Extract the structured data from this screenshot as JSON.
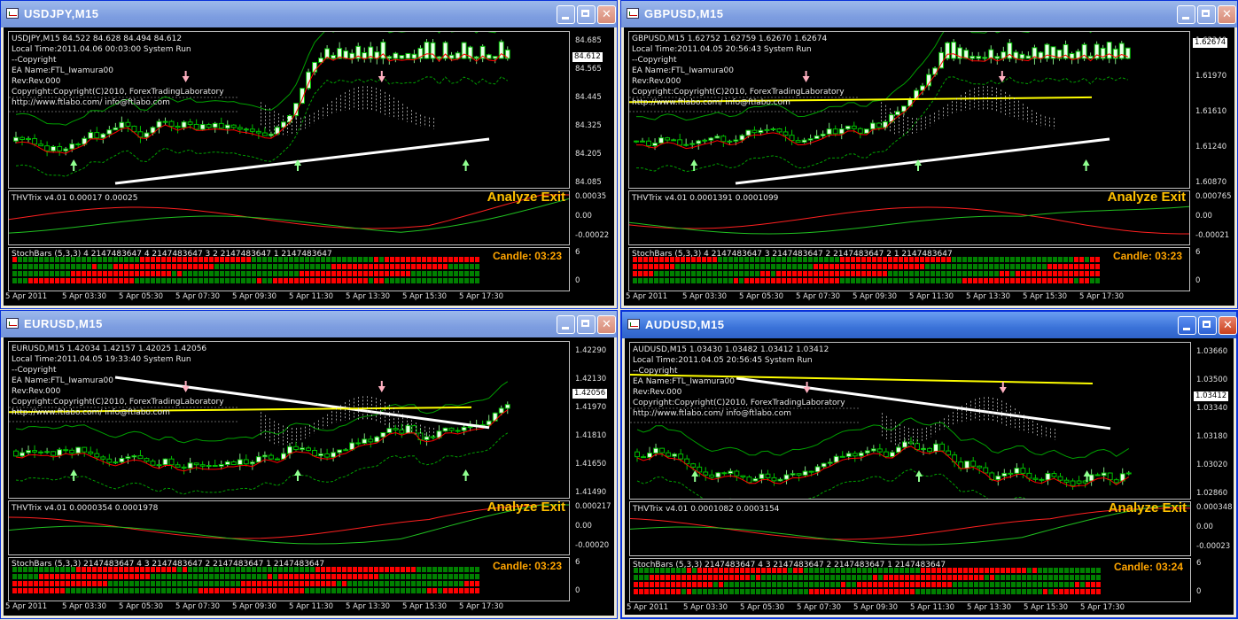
{
  "windows": [
    {
      "title": "USDJPY,M15",
      "active": false,
      "header": "USDJPY,M15  84.522 84.628 84.494 84.612",
      "info": [
        "Local Time:2011.04.06 00:03:00 System Run",
        "--Copyright",
        "EA Name:FTL_Iwamura00",
        "Rev:Rev.000",
        "Copyright:Copyright(C)2010, ForexTradingLaboratory",
        "http://www.ftlabo.com/ info@ftlabo.com"
      ],
      "price_ticks": [
        "84.685",
        "84.565",
        "84.445",
        "84.325",
        "84.205",
        "84.085"
      ],
      "current_price": "84.612",
      "trix_label": "THVTrix v4.01 0.00017 0.00025",
      "trix_ticks": [
        "0.00035",
        "0.00",
        "-0.00022"
      ],
      "stoch_label": "StochBars (5,3,3) 4 2147483647 4 2147483647 3 2 2147483647 1 2147483647",
      "stoch_ticks": [
        "6",
        "0"
      ],
      "candle_time": "Candle:  03:23",
      "exit_label": "Analyze Exit",
      "time_axis": [
        "5 Apr 2011",
        "5 Apr 03:30",
        "5 Apr 05:30",
        "5 Apr 07:30",
        "5 Apr 09:30",
        "5 Apr 11:30",
        "5 Apr 13:30",
        "5 Apr 15:30",
        "5 Apr 17:30"
      ],
      "seed": 3
    },
    {
      "title": "GBPUSD,M15",
      "active": false,
      "header": "GBPUSD,M15  1.62752 1.62759 1.62670 1.62674",
      "info": [
        "Local Time:2011.04.05 20:56:43 System Run",
        "--Copyright",
        "EA Name:FTL_Iwamura00",
        "Rev:Rev.000",
        "Copyright:Copyright(C)2010, ForexTradingLaboratory",
        "http://www.ftlabo.com/ info@ftlabo.com"
      ],
      "price_ticks": [
        "1.62340",
        "1.61970",
        "1.61610",
        "1.61240",
        "1.60870"
      ],
      "current_price": "1.62674",
      "trix_label": "THVTrix v4.01 0.0001391 0.0001099",
      "trix_ticks": [
        "0.000765",
        "0.00",
        "-0.00021"
      ],
      "stoch_label": "StochBars (5,3,3) 4 2147483647 3 2147483647 2 2147483647 2 1 2147483647",
      "stoch_ticks": [
        "6",
        "0"
      ],
      "candle_time": "Candle:  03:23",
      "exit_label": "Analyze Exit",
      "time_axis": [
        "5 Apr 2011",
        "5 Apr 03:30",
        "5 Apr 05:30",
        "5 Apr 07:30",
        "5 Apr 09:30",
        "5 Apr 11:30",
        "5 Apr 13:30",
        "5 Apr 15:30",
        "5 Apr 17:30"
      ],
      "seed": 7
    },
    {
      "title": "EURUSD,M15",
      "active": false,
      "header": "EURUSD,M15  1.42034 1.42157 1.42025 1.42056",
      "info": [
        "Local Time:2011.04.05 19:33:40 System Run",
        "--Copyright",
        "EA Name:FTL_Iwamura00",
        "Rev:Rev.000",
        "Copyright:Copyright(C)2010, ForexTradingLaboratory",
        "http://www.ftlabo.com/ info@ftlabo.com"
      ],
      "price_ticks": [
        "1.42290",
        "1.42130",
        "1.41970",
        "1.41810",
        "1.41650",
        "1.41490"
      ],
      "current_price": "1.42056",
      "trix_label": "THVTrix v4.01 0.0000354 0.0001978",
      "trix_ticks": [
        "0.000217",
        "0.00",
        "-0.00020"
      ],
      "stoch_label": "StochBars (5,3,3) 2147483647 4 3 2147483647 2 2147483647 1 2147483647",
      "stoch_ticks": [
        "6",
        "0"
      ],
      "candle_time": "Candle:  03:23",
      "exit_label": "Analyze Exit",
      "time_axis": [
        "5 Apr 2011",
        "5 Apr 03:30",
        "5 Apr 05:30",
        "5 Apr 07:30",
        "5 Apr 09:30",
        "5 Apr 11:30",
        "5 Apr 13:30",
        "5 Apr 15:30",
        "5 Apr 17:30"
      ],
      "seed": 11
    },
    {
      "title": "AUDUSD,M15",
      "active": true,
      "header": "AUDUSD,M15  1.03430 1.03482 1.03412 1.03412",
      "info": [
        "Local Time:2011.04.05 20:56:45 System Run",
        "--Copyright",
        "EA Name:FTL_Iwamura00",
        "Rev:Rev.000",
        "Copyright:Copyright(C)2010, ForexTradingLaboratory",
        "http://www.ftlabo.com/ info@ftlabo.com"
      ],
      "price_ticks": [
        "1.03660",
        "1.03500",
        "1.03340",
        "1.03180",
        "1.03020",
        "1.02860"
      ],
      "current_price": "1.03412",
      "trix_label": "THVTrix v4.01 0.0001082 0.0003154",
      "trix_ticks": [
        "0.000348",
        "0.00",
        "-0.00023"
      ],
      "stoch_label": "StochBars (5,3,3) 2147483647 4 3 2147483647 2 2147483647 1 2147483647",
      "stoch_ticks": [
        "6",
        "0"
      ],
      "candle_time": "Candle:  03:24",
      "exit_label": "Analyze Exit",
      "time_axis": [
        "5 Apr 2011",
        "5 Apr 03:30",
        "5 Apr 05:30",
        "5 Apr 07:30",
        "5 Apr 09:30",
        "5 Apr 11:30",
        "5 Apr 13:30",
        "5 Apr 15:30",
        "5 Apr 17:30"
      ],
      "seed": 5
    }
  ],
  "colors": {
    "titlebar_active": "#2f62c9",
    "background": "#000000",
    "candle_up": "#ffffff",
    "candle_down": "#00c000",
    "ma_red": "#ff0000",
    "ma_white": "#ffffff",
    "envelope_green": "#00a000",
    "trix_red": "#ff2020",
    "trix_green": "#20c020",
    "stoch_red": "#ff0000",
    "stoch_green": "#008000",
    "exit_text": "#ffc000",
    "candle_text": "#ffa500"
  }
}
